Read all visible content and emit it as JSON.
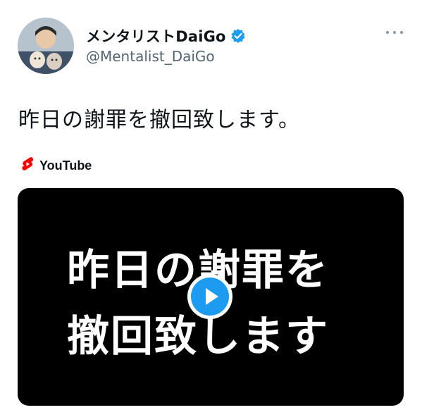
{
  "tweet": {
    "author": {
      "display_name": "メンタリストDaiGo",
      "handle": "@Mentalist_DaiGo",
      "verified": true
    },
    "text": "昨日の謝罪を撤回致します。",
    "more_icon": "more-dots-icon",
    "link_card": {
      "source_label": "YouTube",
      "source_icon": "youtube-shorts-icon",
      "video_thumbnail_lines": [
        "昨日の謝罪を",
        "撤回致します"
      ],
      "play_icon": "play-icon"
    }
  },
  "colors": {
    "verified_badge": "#1d9bf0",
    "shorts_red": "#ff0000",
    "play_blue": "#1d9bf0",
    "handle_gray": "#536471"
  }
}
